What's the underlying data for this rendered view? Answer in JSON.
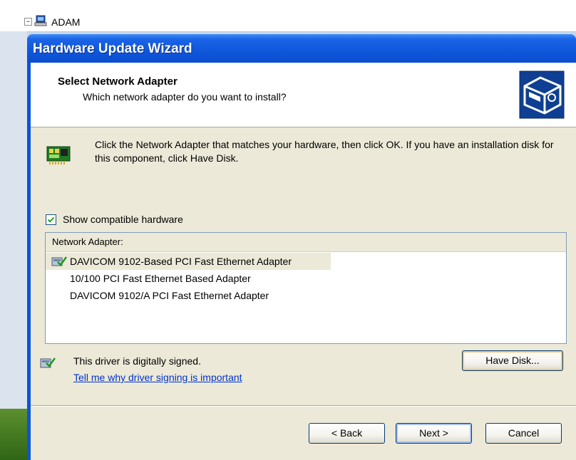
{
  "background": {
    "tree_label": "ADAM",
    "expander_symbol": "−"
  },
  "window": {
    "title": "Hardware Update Wizard"
  },
  "header": {
    "title": "Select Network Adapter",
    "subtitle": "Which network adapter do you want to install?"
  },
  "instruction": "Click the Network Adapter that matches your hardware, then click OK. If you have an installation disk for this component, click Have Disk.",
  "show_compatible": {
    "label": "Show compatible hardware",
    "checked": true
  },
  "list": {
    "header": "Network Adapter:",
    "items": [
      {
        "label": "DAVICOM 9102-Based PCI Fast Ethernet Adapter",
        "selected": true,
        "icon": "signed-driver-icon"
      },
      {
        "label": "10/100 PCI Fast Ethernet Based Adapter",
        "selected": false
      },
      {
        "label": "DAVICOM 9102/A PCI Fast Ethernet Adapter",
        "selected": false
      }
    ]
  },
  "signing": {
    "status": "This driver is digitally signed.",
    "link": "Tell me why driver signing is important"
  },
  "buttons": {
    "have_disk": "Have Disk...",
    "back": "< Back",
    "next": "Next >",
    "cancel": "Cancel"
  },
  "colors": {
    "titlebar": "#0b4ecf",
    "dialog_face": "#ece9d8",
    "link": "#0033cc"
  }
}
